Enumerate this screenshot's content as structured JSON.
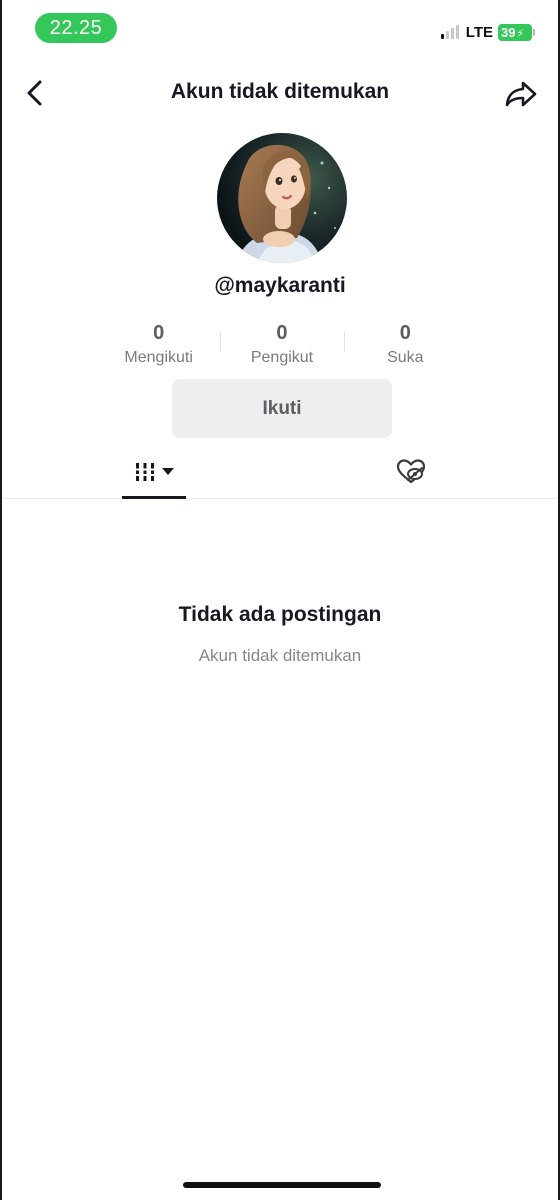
{
  "status_bar": {
    "time": "22.25",
    "network": "LTE",
    "battery_level": "39",
    "battery_color": "#34c759",
    "time_pill_color": "#34c759"
  },
  "header": {
    "title": "Akun tidak ditemukan",
    "back_icon": "chevron-left-icon",
    "share_icon": "share-arrow-icon"
  },
  "profile": {
    "username": "@maykaranti",
    "avatar_icon": "profile-avatar"
  },
  "stats": [
    {
      "value": "0",
      "label": "Mengikuti"
    },
    {
      "value": "0",
      "label": "Pengikut"
    },
    {
      "value": "0",
      "label": "Suka"
    }
  ],
  "follow_button": {
    "label": "Ikuti"
  },
  "tabs": {
    "videos_icon": "grid-icon",
    "liked_icon": "hidden-heart-icon"
  },
  "empty_state": {
    "title": "Tidak ada postingan",
    "subtitle": "Akun tidak ditemukan"
  }
}
